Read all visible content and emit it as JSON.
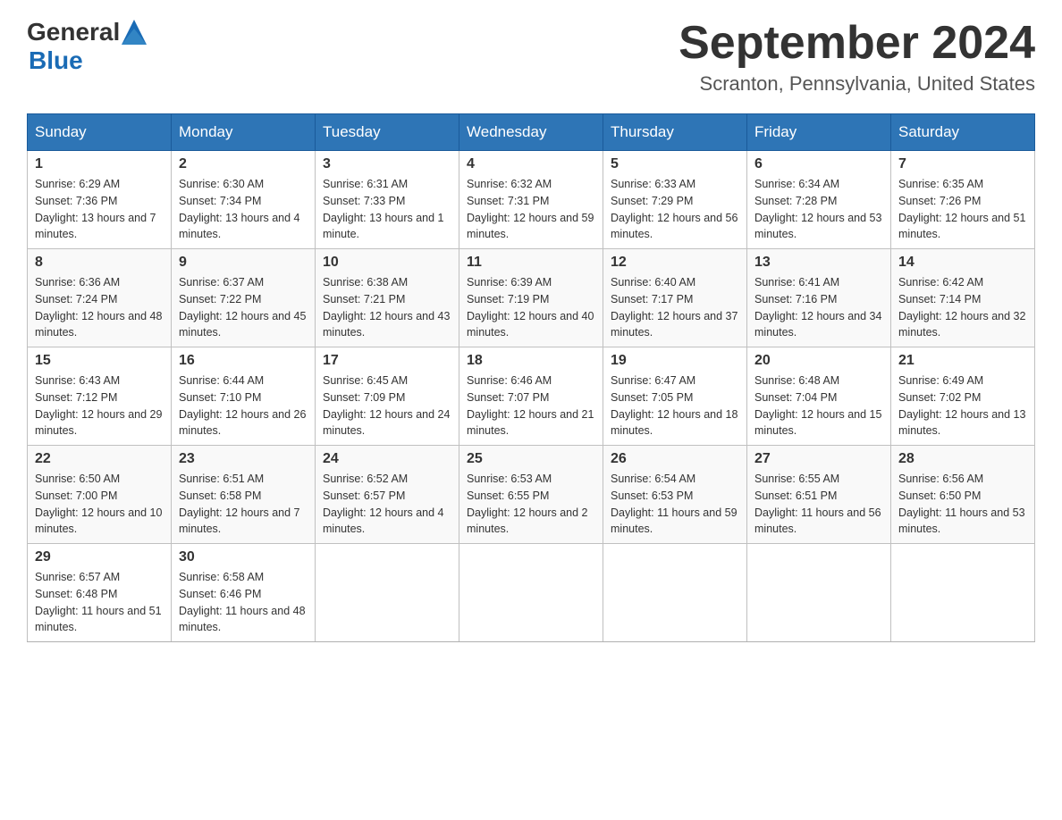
{
  "header": {
    "logo_general": "General",
    "logo_blue": "Blue",
    "month_title": "September 2024",
    "location": "Scranton, Pennsylvania, United States"
  },
  "columns": [
    "Sunday",
    "Monday",
    "Tuesday",
    "Wednesday",
    "Thursday",
    "Friday",
    "Saturday"
  ],
  "weeks": [
    [
      {
        "day": "1",
        "sunrise": "Sunrise: 6:29 AM",
        "sunset": "Sunset: 7:36 PM",
        "daylight": "Daylight: 13 hours and 7 minutes."
      },
      {
        "day": "2",
        "sunrise": "Sunrise: 6:30 AM",
        "sunset": "Sunset: 7:34 PM",
        "daylight": "Daylight: 13 hours and 4 minutes."
      },
      {
        "day": "3",
        "sunrise": "Sunrise: 6:31 AM",
        "sunset": "Sunset: 7:33 PM",
        "daylight": "Daylight: 13 hours and 1 minute."
      },
      {
        "day": "4",
        "sunrise": "Sunrise: 6:32 AM",
        "sunset": "Sunset: 7:31 PM",
        "daylight": "Daylight: 12 hours and 59 minutes."
      },
      {
        "day": "5",
        "sunrise": "Sunrise: 6:33 AM",
        "sunset": "Sunset: 7:29 PM",
        "daylight": "Daylight: 12 hours and 56 minutes."
      },
      {
        "day": "6",
        "sunrise": "Sunrise: 6:34 AM",
        "sunset": "Sunset: 7:28 PM",
        "daylight": "Daylight: 12 hours and 53 minutes."
      },
      {
        "day": "7",
        "sunrise": "Sunrise: 6:35 AM",
        "sunset": "Sunset: 7:26 PM",
        "daylight": "Daylight: 12 hours and 51 minutes."
      }
    ],
    [
      {
        "day": "8",
        "sunrise": "Sunrise: 6:36 AM",
        "sunset": "Sunset: 7:24 PM",
        "daylight": "Daylight: 12 hours and 48 minutes."
      },
      {
        "day": "9",
        "sunrise": "Sunrise: 6:37 AM",
        "sunset": "Sunset: 7:22 PM",
        "daylight": "Daylight: 12 hours and 45 minutes."
      },
      {
        "day": "10",
        "sunrise": "Sunrise: 6:38 AM",
        "sunset": "Sunset: 7:21 PM",
        "daylight": "Daylight: 12 hours and 43 minutes."
      },
      {
        "day": "11",
        "sunrise": "Sunrise: 6:39 AM",
        "sunset": "Sunset: 7:19 PM",
        "daylight": "Daylight: 12 hours and 40 minutes."
      },
      {
        "day": "12",
        "sunrise": "Sunrise: 6:40 AM",
        "sunset": "Sunset: 7:17 PM",
        "daylight": "Daylight: 12 hours and 37 minutes."
      },
      {
        "day": "13",
        "sunrise": "Sunrise: 6:41 AM",
        "sunset": "Sunset: 7:16 PM",
        "daylight": "Daylight: 12 hours and 34 minutes."
      },
      {
        "day": "14",
        "sunrise": "Sunrise: 6:42 AM",
        "sunset": "Sunset: 7:14 PM",
        "daylight": "Daylight: 12 hours and 32 minutes."
      }
    ],
    [
      {
        "day": "15",
        "sunrise": "Sunrise: 6:43 AM",
        "sunset": "Sunset: 7:12 PM",
        "daylight": "Daylight: 12 hours and 29 minutes."
      },
      {
        "day": "16",
        "sunrise": "Sunrise: 6:44 AM",
        "sunset": "Sunset: 7:10 PM",
        "daylight": "Daylight: 12 hours and 26 minutes."
      },
      {
        "day": "17",
        "sunrise": "Sunrise: 6:45 AM",
        "sunset": "Sunset: 7:09 PM",
        "daylight": "Daylight: 12 hours and 24 minutes."
      },
      {
        "day": "18",
        "sunrise": "Sunrise: 6:46 AM",
        "sunset": "Sunset: 7:07 PM",
        "daylight": "Daylight: 12 hours and 21 minutes."
      },
      {
        "day": "19",
        "sunrise": "Sunrise: 6:47 AM",
        "sunset": "Sunset: 7:05 PM",
        "daylight": "Daylight: 12 hours and 18 minutes."
      },
      {
        "day": "20",
        "sunrise": "Sunrise: 6:48 AM",
        "sunset": "Sunset: 7:04 PM",
        "daylight": "Daylight: 12 hours and 15 minutes."
      },
      {
        "day": "21",
        "sunrise": "Sunrise: 6:49 AM",
        "sunset": "Sunset: 7:02 PM",
        "daylight": "Daylight: 12 hours and 13 minutes."
      }
    ],
    [
      {
        "day": "22",
        "sunrise": "Sunrise: 6:50 AM",
        "sunset": "Sunset: 7:00 PM",
        "daylight": "Daylight: 12 hours and 10 minutes."
      },
      {
        "day": "23",
        "sunrise": "Sunrise: 6:51 AM",
        "sunset": "Sunset: 6:58 PM",
        "daylight": "Daylight: 12 hours and 7 minutes."
      },
      {
        "day": "24",
        "sunrise": "Sunrise: 6:52 AM",
        "sunset": "Sunset: 6:57 PM",
        "daylight": "Daylight: 12 hours and 4 minutes."
      },
      {
        "day": "25",
        "sunrise": "Sunrise: 6:53 AM",
        "sunset": "Sunset: 6:55 PM",
        "daylight": "Daylight: 12 hours and 2 minutes."
      },
      {
        "day": "26",
        "sunrise": "Sunrise: 6:54 AM",
        "sunset": "Sunset: 6:53 PM",
        "daylight": "Daylight: 11 hours and 59 minutes."
      },
      {
        "day": "27",
        "sunrise": "Sunrise: 6:55 AM",
        "sunset": "Sunset: 6:51 PM",
        "daylight": "Daylight: 11 hours and 56 minutes."
      },
      {
        "day": "28",
        "sunrise": "Sunrise: 6:56 AM",
        "sunset": "Sunset: 6:50 PM",
        "daylight": "Daylight: 11 hours and 53 minutes."
      }
    ],
    [
      {
        "day": "29",
        "sunrise": "Sunrise: 6:57 AM",
        "sunset": "Sunset: 6:48 PM",
        "daylight": "Daylight: 11 hours and 51 minutes."
      },
      {
        "day": "30",
        "sunrise": "Sunrise: 6:58 AM",
        "sunset": "Sunset: 6:46 PM",
        "daylight": "Daylight: 11 hours and 48 minutes."
      },
      null,
      null,
      null,
      null,
      null
    ]
  ]
}
